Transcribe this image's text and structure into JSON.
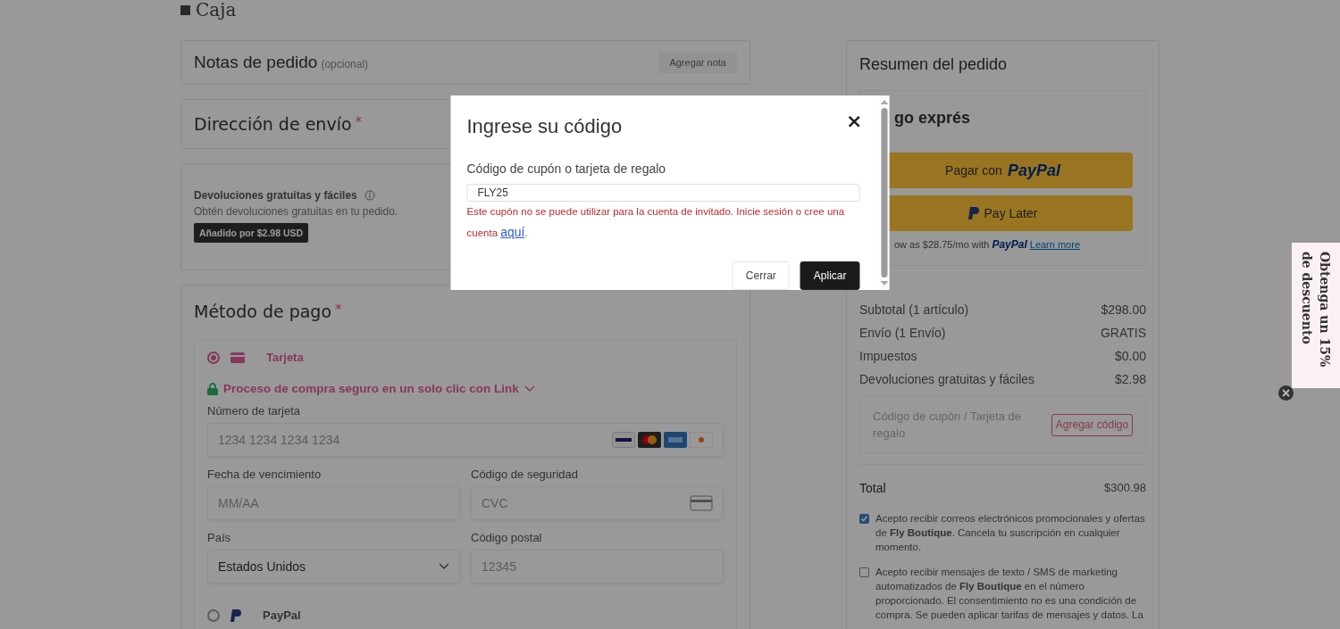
{
  "header": {
    "title": "Caja"
  },
  "order_notes": {
    "title": "Notas de pedido",
    "hint": "(opcional)",
    "button": "Agregar nota"
  },
  "shipping": {
    "title": "Dirección de envío",
    "required_mark": "*"
  },
  "returns": {
    "title": "Devoluciones gratuitas y fáciles",
    "description": "Obtén devoluciones gratuitas en tu pedido.",
    "badge": "Añadido por $2.98 USD"
  },
  "payment": {
    "title": "Método de pago",
    "required_mark": "*",
    "link_banner": "Proceso de compra seguro en un solo clic con Link",
    "methods": [
      {
        "label": "Tarjeta",
        "selected": true
      },
      {
        "label": "PayPal",
        "selected": false
      }
    ],
    "fields": [
      {
        "kind": "card",
        "label": "Número de tarjeta",
        "placeholder": "1234 1234 1234 1234"
      },
      {
        "kind": "text",
        "label": "Fecha de vencimiento",
        "placeholder": "MM/AA"
      },
      {
        "kind": "cvc",
        "label": "Código de seguridad",
        "placeholder": "CVC"
      },
      {
        "kind": "select",
        "label": "País",
        "value": "Estados Unidos"
      },
      {
        "kind": "text",
        "label": "Código postal",
        "placeholder": "12345"
      }
    ]
  },
  "summary": {
    "title": "Resumen del pedido",
    "express_title": "go exprés",
    "paypal_button": {
      "prefix": "Pagar con",
      "brand": "PayPal"
    },
    "pay_later_button": "Pay Later",
    "pay_later_note": {
      "text": "ow as $28.75/mo with",
      "brand": "PayPal",
      "link": "Learn more"
    },
    "rows": [
      {
        "label": "Subtotal (1 artículo)",
        "value": "$298.00"
      },
      {
        "label": "Envío (1 Envío)",
        "value": "GRATIS"
      },
      {
        "label": "Impuestos",
        "value": "$0.00"
      },
      {
        "label": "Devoluciones gratuitas y fáciles",
        "value": "$2.98"
      }
    ],
    "coupon": {
      "placeholder": "Código de cupón / Tarjeta de regalo",
      "button": "Agregar código"
    },
    "total": {
      "label": "Total",
      "value": "$300.98"
    },
    "consents": [
      {
        "checked": true,
        "text": "Acepto recibir correos electrónicos promocionales y ofertas de **Fly Boutique**. Cancela tu suscripción en cualquier momento."
      },
      {
        "checked": false,
        "text": "Acepto recibir mensajes de texto / SMS de marketing automatizados de **Fly Boutique** en el número proporcionado. El consentimiento no es una condición de compra. Se pueden aplicar tarifas de mensajes y datos. La"
      }
    ]
  },
  "modal": {
    "title": "Ingrese su código",
    "close": "×",
    "field_label": "Código de cupón o tarjeta de regalo",
    "value": "FLY25",
    "error": "Este cupón no se puede utilizar para la cuenta de invitado. Inicie sesión o cree una cuenta",
    "error_link": "aquí",
    "error_end": ".",
    "buttons": [
      {
        "label": "Cerrar",
        "kind": "secondary"
      },
      {
        "label": "Aplicar",
        "kind": "primary"
      }
    ]
  },
  "promo_tab": {
    "text": "Obtenga un 15% de descuento"
  }
}
